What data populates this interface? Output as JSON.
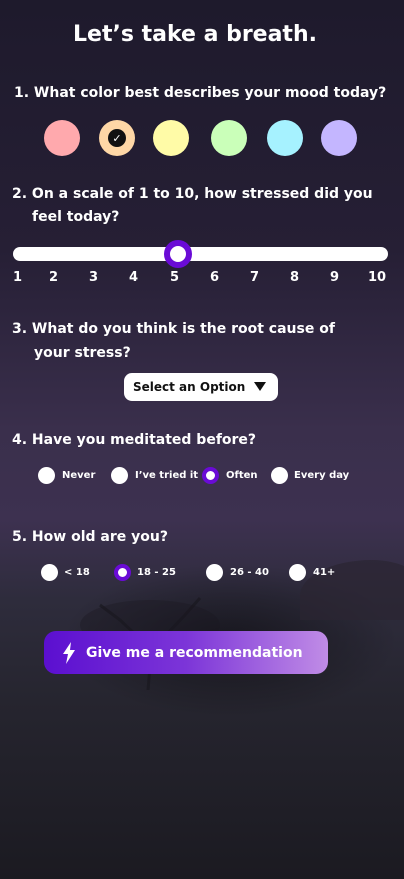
{
  "title": "Let’s take a breath.",
  "q1": {
    "label": "1. What color best describes your mood today?",
    "colors": [
      "#ffa9ad",
      "#fed7a6",
      "#fffba7",
      "#caffb9",
      "#a6f2ff",
      "#c4b6ff"
    ],
    "selected_index": 1
  },
  "q2": {
    "label_line1": "2. On a scale of 1 to 10, how stressed did you",
    "label_line2": "feel today?",
    "ticks": [
      "1",
      "2",
      "3",
      "4",
      "5",
      "6",
      "7",
      "8",
      "9",
      "10"
    ],
    "value": 5
  },
  "q3": {
    "label_line1": "3. What do you think is the root cause of",
    "label_line2": "your stress?",
    "select_placeholder": "Select an Option"
  },
  "q4": {
    "label": "4. Have you meditated before?",
    "options": [
      "Never",
      "I’ve tried it",
      "Often",
      "Every day"
    ],
    "selected": "Often"
  },
  "q5": {
    "label": "5. How old are you?",
    "options": [
      "< 18",
      "18 - 25",
      "26 - 40",
      "41+"
    ],
    "selected": "18 - 25"
  },
  "cta": {
    "label": "Give me a recommendation",
    "icon": "lightning-icon"
  },
  "accent": "#6a0bd6"
}
